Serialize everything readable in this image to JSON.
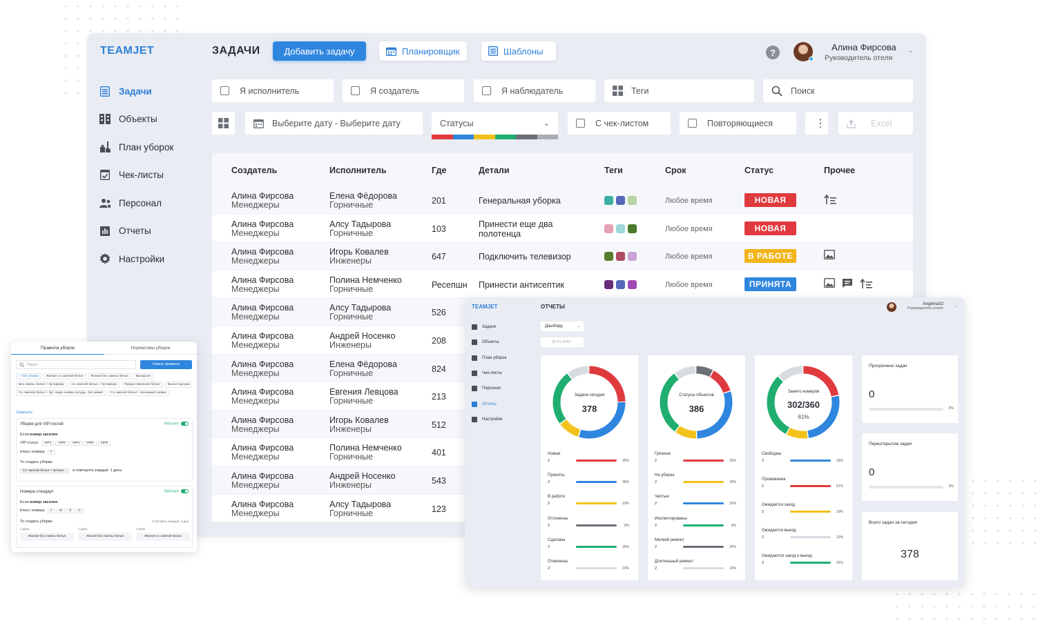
{
  "brand": "TEAMJET",
  "header": {
    "title": "ЗАДАЧИ",
    "add_button": "Добавить задачу",
    "planner_button": "Планировщик",
    "templates_button": "Шаблоны",
    "user_name": "Алина Фирсова",
    "user_role": "Руководитель отеля"
  },
  "sidebar": {
    "items": [
      {
        "label": "Задачи",
        "icon": "tasks-icon"
      },
      {
        "label": "Объекты",
        "icon": "objects-icon"
      },
      {
        "label": "План уборок",
        "icon": "cleaning-icon"
      },
      {
        "label": "Чек-листы",
        "icon": "checklist-icon"
      },
      {
        "label": "Персонал",
        "icon": "staff-icon"
      },
      {
        "label": "Отчеты",
        "icon": "reports-icon"
      },
      {
        "label": "Настройки",
        "icon": "settings-icon"
      }
    ]
  },
  "filters": {
    "executor": "Я исполнитель",
    "creator": "Я создатель",
    "observer": "Я наблюдатель",
    "tags": "Теги",
    "search": "Поиск",
    "date": "Выберите дату - Выберите дату",
    "statuses": "Статусы",
    "checklist": "С чек-листом",
    "repeating": "Повторяющиеся",
    "excel": "Excel"
  },
  "status_colors": [
    "#e03a3e",
    "#2f86de",
    "#f2c21b",
    "#1fae6f",
    "#6b6f77",
    "#a9aeb6"
  ],
  "table": {
    "headers": {
      "creator": "Создатель",
      "executor": "Исполнитель",
      "where": "Где",
      "details": "Детали",
      "tags": "Теги",
      "deadline": "Срок",
      "status": "Статус",
      "other": "Прочее"
    },
    "rows": [
      {
        "creator": "Алина Фирсова",
        "creator_role": "Менеджеры",
        "executor": "Елена Фёдорова",
        "executor_role": "Горничные",
        "where": "201",
        "details": "Генеральная уборка",
        "tags": [
          "#3bb0a0",
          "#5569b8",
          "#b8d4a2"
        ],
        "deadline": "Любое время",
        "status": "НОВАЯ",
        "status_color": "#e03a3e",
        "other": [
          "sort-icon"
        ]
      },
      {
        "creator": "Алина Фирсова",
        "creator_role": "Менеджеры",
        "executor": "Алсу Тадырова",
        "executor_role": "Горничные",
        "where": "103",
        "details": "Принести еще два полотенца",
        "tags": [
          "#e6a1b3",
          "#9fd6d8",
          "#4a7a2c"
        ],
        "deadline": "Любое время",
        "status": "НОВАЯ",
        "status_color": "#e03a3e",
        "other": []
      },
      {
        "creator": "Алина Фирсова",
        "creator_role": "Менеджеры",
        "executor": "Игорь Ковалев",
        "executor_role": "Инженеры",
        "where": "647",
        "details": "Подключить телевизор",
        "tags": [
          "#5a7a2c",
          "#b04a62",
          "#c9a3d8"
        ],
        "deadline": "Любое время",
        "status": "В РАБОТЕ",
        "status_color": "#f2b41b",
        "other": [
          "image-icon"
        ]
      },
      {
        "creator": "Алина Фирсова",
        "creator_role": "Менеджеры",
        "executor": "Полина Немченко",
        "executor_role": "Горничные",
        "where": "Ресепшн",
        "details": "Принести антисептик",
        "tags": [
          "#6a2c7a",
          "#5569b8",
          "#a14bb8"
        ],
        "deadline": "Любое время",
        "status": "ПРИНЯТА",
        "status_color": "#2f86de",
        "other": [
          "image-icon",
          "comment-icon",
          "sort-icon"
        ]
      },
      {
        "creator": "Алина Фирсова",
        "creator_role": "Менеджеры",
        "executor": "Алсу Тадырова",
        "executor_role": "Горничные",
        "where": "526"
      },
      {
        "creator": "Алина Фирсова",
        "creator_role": "Менеджеры",
        "executor": "Андрей Носенко",
        "executor_role": "Инженеры",
        "where": "208"
      },
      {
        "creator": "Алина Фирсова",
        "creator_role": "Менеджеры",
        "executor": "Елена Фёдорова",
        "executor_role": "Горничные",
        "where": "824"
      },
      {
        "creator": "Алина Фирсова",
        "creator_role": "Менеджеры",
        "executor": "Евгения Левцова",
        "executor_role": "Горничные",
        "where": "213"
      },
      {
        "creator": "Алина Фирсова",
        "creator_role": "Менеджеры",
        "executor": "Игорь Ковалев",
        "executor_role": "Инженеры",
        "where": "512"
      },
      {
        "creator": "Алина Фирсова",
        "creator_role": "Менеджеры",
        "executor": "Полина Немченко",
        "executor_role": "Горничные",
        "where": "401"
      },
      {
        "creator": "Алина Фирсова",
        "creator_role": "Менеджеры",
        "executor": "Андрей Носенко",
        "executor_role": "Инженеры",
        "where": "543"
      },
      {
        "creator": "Алина Фирсова",
        "creator_role": "Менеджеры",
        "executor": "Алсу Тадырова",
        "executor_role": "Горничные",
        "where": "123"
      }
    ]
  },
  "reports": {
    "brand": "TEAMJET",
    "title": "ОТЧЕТЫ",
    "user": "Angelina32",
    "role": "Руководитель отеля",
    "view_select": "Дашборд",
    "date": "05.01.2020",
    "nav": [
      "Задачи",
      "Объекты",
      "План уборок",
      "Чек-листы",
      "Персонал",
      "Отчеты",
      "Настройки"
    ],
    "cards": [
      {
        "caption": "Задачи сегодня",
        "value": "378",
        "sub": "",
        "segments": [
          {
            "v": 25,
            "c": "#e03a3e"
          },
          {
            "v": 30,
            "c": "#2f86de"
          },
          {
            "v": 10,
            "c": "#f2c21b"
          },
          {
            "v": 25,
            "c": "#1fae6f"
          },
          {
            "v": 10,
            "c": "#d7dbe2"
          }
        ],
        "stats": [
          {
            "label": "Новые",
            "n": "2",
            "pct": "25%",
            "c": "#e03a3e"
          },
          {
            "label": "Приняты",
            "n": "2",
            "pct": "30%",
            "c": "#2f86de"
          },
          {
            "label": "В работе",
            "n": "2",
            "pct": "10%",
            "c": "#f2c21b"
          },
          {
            "label": "Отложены",
            "n": "2",
            "pct": "0%",
            "c": "#6b6f77"
          },
          {
            "label": "Сделаны",
            "n": "2",
            "pct": "25%",
            "c": "#1fae6f"
          },
          {
            "label": "Отменены",
            "n": "2",
            "pct": "10%",
            "c": "#d7dbe2"
          }
        ]
      },
      {
        "caption": "Статусы объектов",
        "value": "386",
        "sub": "",
        "segments": [
          {
            "v": 8,
            "c": "#6b6f77"
          },
          {
            "v": 12,
            "c": "#e03a3e"
          },
          {
            "v": 30,
            "c": "#2f86de"
          },
          {
            "v": 10,
            "c": "#f2c21b"
          },
          {
            "v": 30,
            "c": "#1fae6f"
          },
          {
            "v": 10,
            "c": "#d7dbe2"
          }
        ],
        "stats": [
          {
            "label": "Грязные",
            "n": "2",
            "pct": "25%",
            "c": "#e03a3e"
          },
          {
            "label": "На уборке",
            "n": "2",
            "pct": "30%",
            "c": "#f2c21b"
          },
          {
            "label": "Чистые",
            "n": "2",
            "pct": "10%",
            "c": "#2f86de"
          },
          {
            "label": "Инспектированы",
            "n": "2",
            "pct": "0%",
            "c": "#1fae6f"
          },
          {
            "label": "Мелкий ремонт",
            "n": "2",
            "pct": "25%",
            "c": "#6b6f77"
          },
          {
            "label": "Длительный ремонт",
            "n": "2",
            "pct": "10%",
            "c": "#d7dbe2"
          }
        ]
      },
      {
        "caption": "Занято номеров",
        "value": "302/360",
        "sub": "61%",
        "segments": [
          {
            "v": 22,
            "c": "#e03a3e"
          },
          {
            "v": 26,
            "c": "#2f86de"
          },
          {
            "v": 10,
            "c": "#f2c21b"
          },
          {
            "v": 30,
            "c": "#1fae6f"
          },
          {
            "v": 12,
            "c": "#d7dbe2"
          }
        ],
        "stats": [
          {
            "label": "Свободны",
            "n": "2",
            "pct": "19%",
            "c": "#2f86de"
          },
          {
            "label": "Проживание",
            "n": "2",
            "pct": "61%",
            "c": "#e03a3e"
          },
          {
            "label": "Ожидается заезд",
            "n": "2",
            "pct": "10%",
            "c": "#f2c21b"
          },
          {
            "label": "Ожидается выезд",
            "n": "2",
            "pct": "10%",
            "c": "#d7dbe2"
          },
          {
            "label": "Ожидаются заезд и выезд",
            "n": "2",
            "pct": "25%",
            "c": "#1fae6f"
          }
        ]
      }
    ],
    "small_cards": [
      {
        "title": "Просрочено задач",
        "value": "0",
        "pct": "0%"
      },
      {
        "title": "Переоткрытие задач",
        "value": "0",
        "pct": "0%"
      },
      {
        "title": "Всего задач за сегодня",
        "value": "378",
        "pct": ""
      }
    ]
  },
  "rules": {
    "tab1": "Правила уборок",
    "tab2": "Нормативы уборок",
    "search": "Поиск",
    "new_rule": "Новое правило",
    "chips": [
      "+ Тип уборки",
      "Жилая со сменой белья",
      "Жилая без смены белья",
      "Выезд-ая",
      "Без смены белья + бутафора",
      "Со сменой белья + бутафора",
      "Предоставление белья",
      "Вынос мусора",
      "Со сменой белья + бут. вода, мойка посуды, бит.химия",
      "Со сменой белья + вечерний сервис"
    ],
    "collapse": "Свернуть",
    "block1": {
      "title": "Уборки для VIP-гостей",
      "active": "Работает",
      "cond": "Если",
      "cond_bold": "номер заселен",
      "vip_label": "VIP-статус",
      "vip": [
        "VIP1",
        "VIP2",
        "VIP3",
        "VIP5",
        "VIP8"
      ],
      "class_label": "Класс номера",
      "classes": [
        "A"
      ],
      "create": "То создать уборки:",
      "task": "Со сменой белья + вечерн...",
      "repeat": "и повторять каждый",
      "repeat_val": "1 день"
    },
    "block2": {
      "title": "Номера стандарт",
      "active": "Работает",
      "cond": "Если",
      "cond_bold": "номер заселен",
      "class_label": "Класс номера",
      "classes": [
        "A",
        "M",
        "O",
        "S"
      ],
      "create": "То создать уборки:",
      "period": "Повторять каждые: 3 дня",
      "days": [
        "1 день",
        "2 день",
        "3 день"
      ],
      "tasks": [
        "Жилая без смены белья",
        "Жилая без смены белья",
        "Жилая со сменой белья"
      ]
    }
  }
}
